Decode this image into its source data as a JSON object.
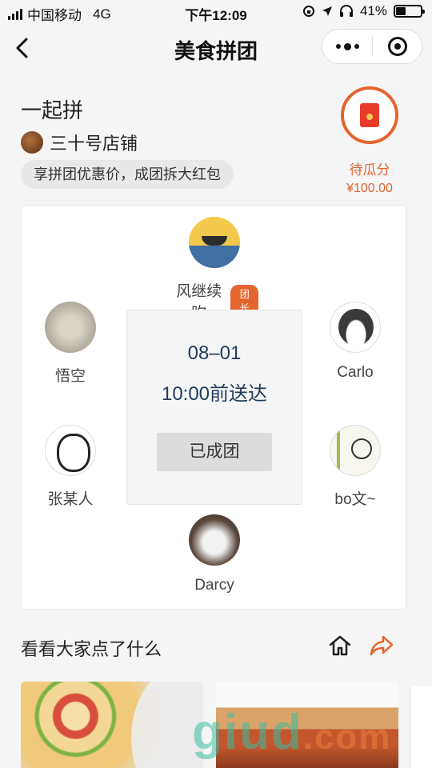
{
  "status_bar": {
    "carrier": "中国移动",
    "network": "4G",
    "time": "下午12:09",
    "battery": "41%",
    "battery_level": 0.41
  },
  "nav": {
    "title": "美食拼团"
  },
  "header": {
    "title": "一起拼",
    "shop_name": "三十号店铺",
    "promo": "享拼团优惠价，成团拆大红包"
  },
  "redpack": {
    "label": "待瓜分",
    "amount": "¥100.00"
  },
  "group": {
    "leader": {
      "name": "风继续吹",
      "badge": "团长"
    },
    "members": [
      {
        "name": "悟空"
      },
      {
        "name": "Carlo"
      },
      {
        "name": "张某人"
      },
      {
        "name": "bo文~"
      },
      {
        "name": "Darcy"
      }
    ],
    "delivery_date": "08–01",
    "delivery_time": "10:00前送达",
    "status": "已成团"
  },
  "section": {
    "title": "看看大家点了什么"
  },
  "watermark": {
    "main": "giud",
    "suffix": ".com"
  },
  "colors": {
    "accent": "#e4652e",
    "date_text": "#1f3b5b",
    "background": "#f5f5f5"
  }
}
